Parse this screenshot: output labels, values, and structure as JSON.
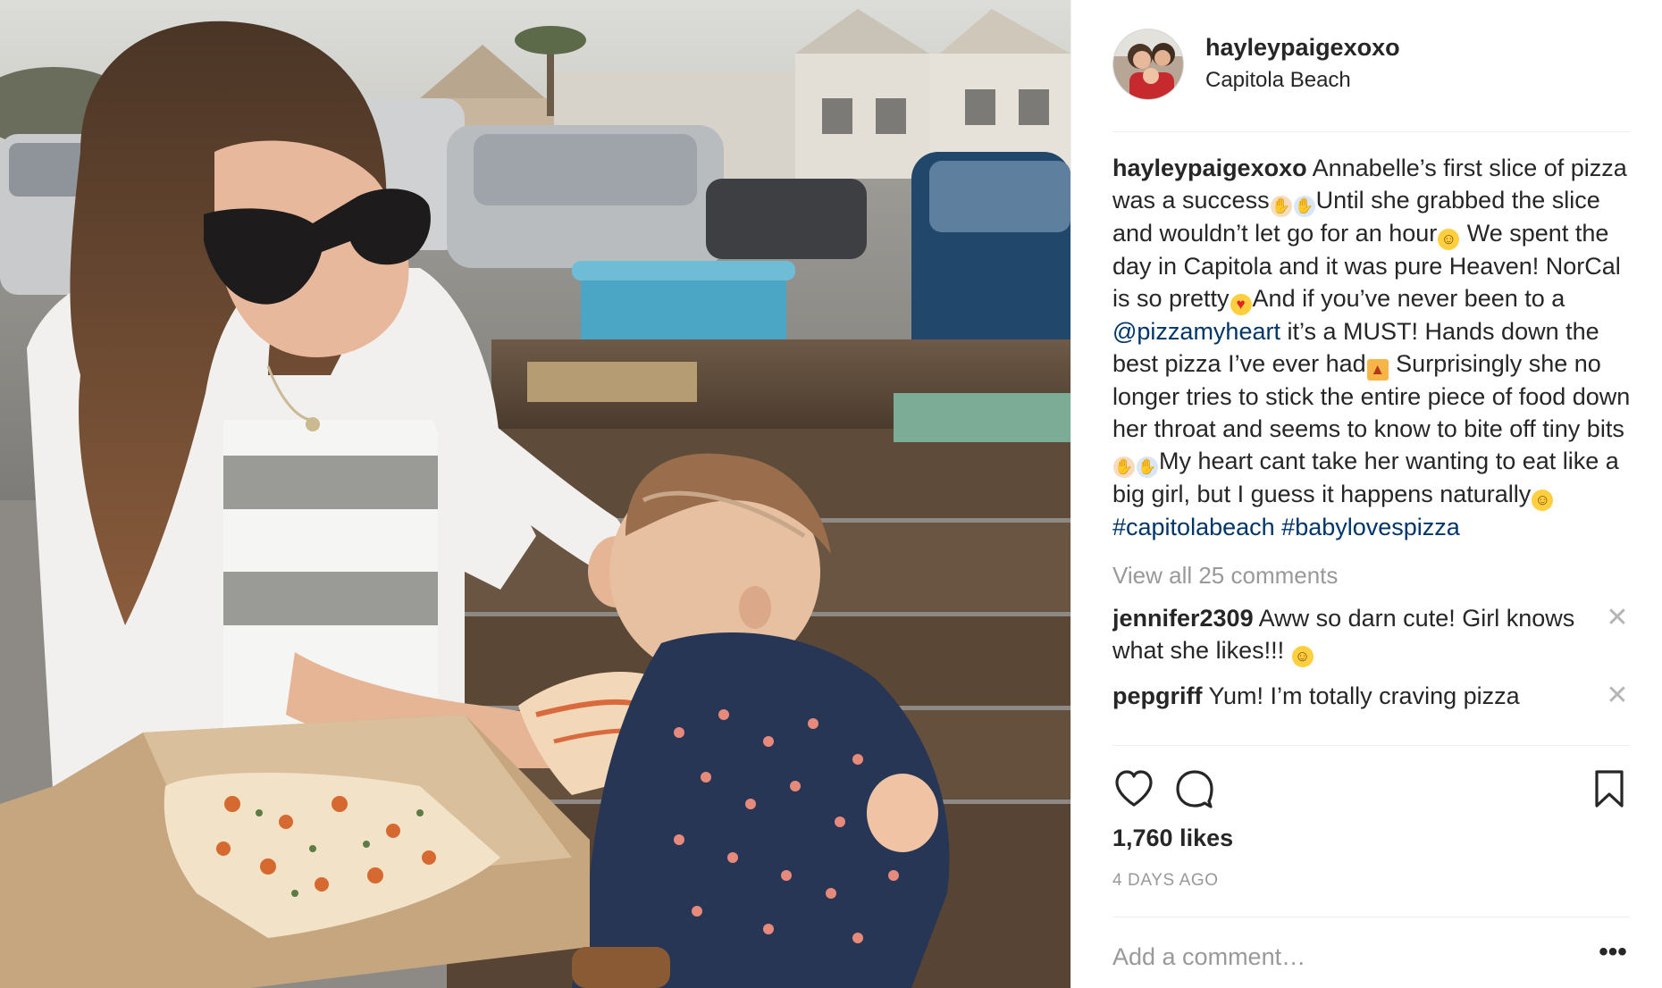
{
  "post": {
    "username": "hayleypaigexoxo",
    "location": "Capitola Beach",
    "caption": {
      "username": "hayleypaigexoxo",
      "text_1": " Annabelle’s first slice of pizza was a success",
      "text_2": "Until she grabbed the slice and wouldn’t let go for an hour",
      "text_3": " We spent the day in Capitola and it was pure Heaven! NorCal is so pretty",
      "text_4": "And if you’ve never been to a ",
      "mention": "@pizzamyheart",
      "text_5": " it’s a MUST! Hands down the best pizza I’ve ever had",
      "text_6": " Surprisingly she no longer tries to stick the entire piece of food down her throat and seems to know to bite off tiny bits",
      "text_7": "My heart cant take her wanting to eat like a big girl, but I guess it happens naturally",
      "hashtag_1": "#capitolabeach",
      "hashtag_2": "#babylovespizza"
    },
    "view_all_comments": "View all 25 comments",
    "comments": [
      {
        "username": "jennifer2309",
        "text": " Aww so darn cute! Girl knows what she likes!!! "
      },
      {
        "username": "pepgriff",
        "text": " Yum! I’m totally craving pizza"
      }
    ],
    "likes": "1,760 likes",
    "timestamp": "4 DAYS AGO",
    "comment_placeholder": "Add a comment…",
    "more_label": "•••",
    "close_glyph": "✕"
  },
  "icons": {
    "like": "heart-icon",
    "comment": "comment-bubble-icon",
    "save": "bookmark-icon",
    "more": "more-options-icon",
    "remove_comment": "close-icon"
  },
  "colors": {
    "text": "#262626",
    "secondary": "#999999",
    "link": "#003569",
    "divider": "#efefef"
  }
}
